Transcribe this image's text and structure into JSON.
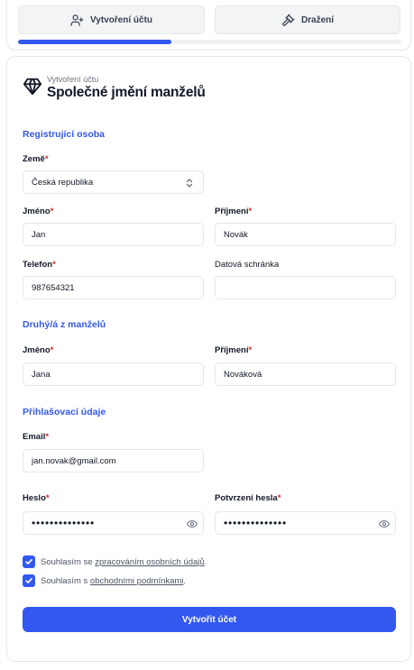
{
  "tabs": {
    "create_account": "Vytvoření účtu",
    "auction": "Dražení"
  },
  "progress": {
    "fraction": 0.4
  },
  "header": {
    "subtitle": "Vytvoření účtu",
    "title": "Společné jmění manželů"
  },
  "sections": {
    "registrant": "Registrující osoba",
    "spouse": "Druhý/á z manželů",
    "login": "Přihlašovací údaje"
  },
  "registrant": {
    "country_label": "Země",
    "country_value": "Česká republika",
    "first_name_label": "Jméno",
    "first_name_value": "Jan",
    "last_name_label": "Příjmení",
    "last_name_value": "Novák",
    "phone_label": "Telefon",
    "phone_value": "987654321",
    "databox_label": "Datová schránka",
    "databox_value": ""
  },
  "spouse": {
    "first_name_label": "Jméno",
    "first_name_value": "Jana",
    "last_name_label": "Příjmení",
    "last_name_value": "Nováková"
  },
  "login": {
    "email_label": "Email",
    "email_value": "jan.novak@gmail.com",
    "password_label": "Heslo",
    "password_value": "••••••••••••••",
    "confirm_label": "Potvrzení hesla",
    "confirm_value": "••••••••••••••"
  },
  "required_mark": "*",
  "consents": {
    "c1_prefix": "Souhlasím se ",
    "c1_link": "zpracováním osobních údajů",
    "c1_suffix": ".",
    "c2_prefix": "Souhlasím s ",
    "c2_link": "obchodními podmínkami",
    "c2_suffix": "."
  },
  "submit_label": "Vytvořit účet",
  "colors": {
    "accent": "#3358f0",
    "required": "#dc2626"
  }
}
